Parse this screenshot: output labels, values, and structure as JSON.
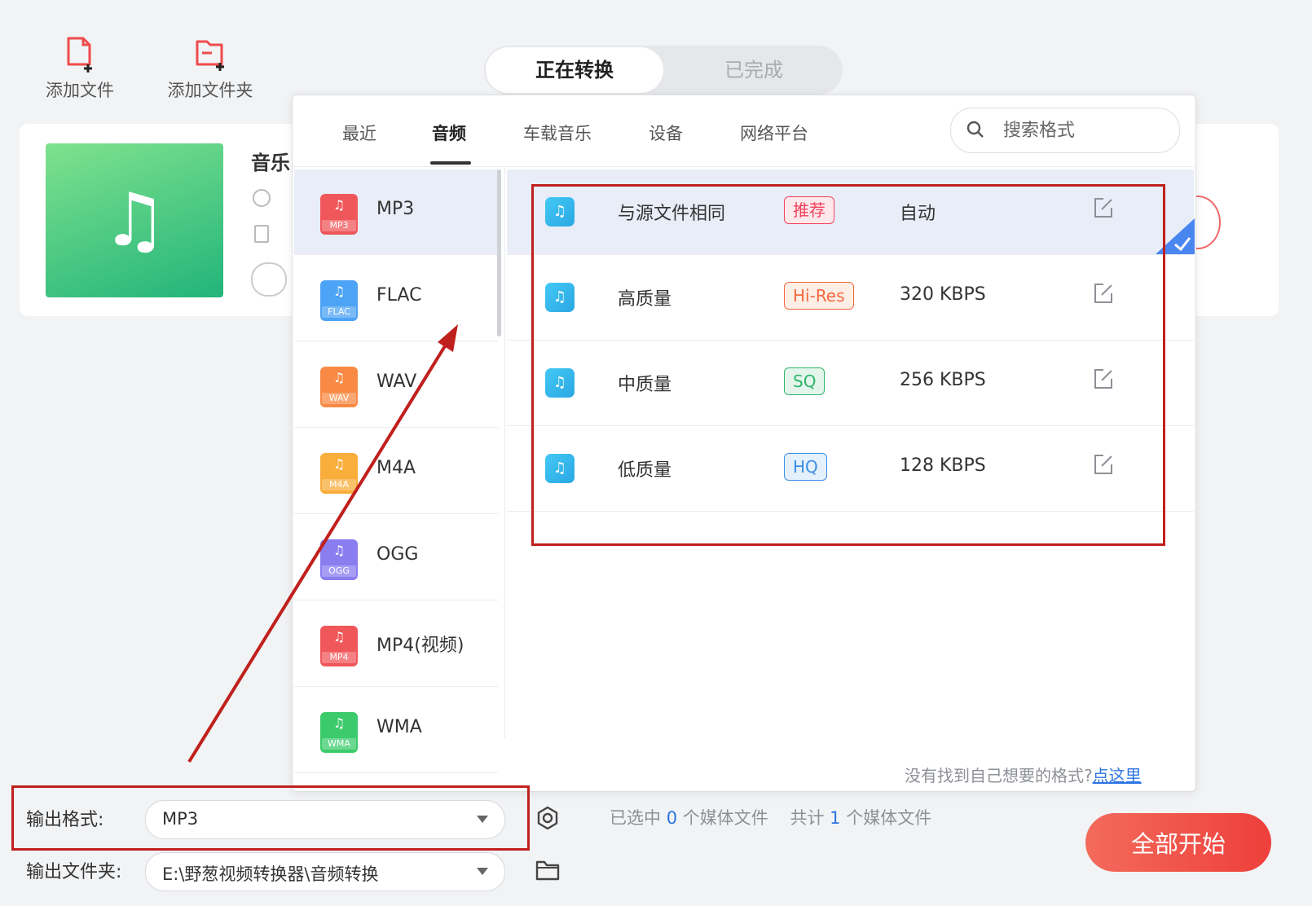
{
  "toolbar": {
    "add_file": "添加文件",
    "add_folder": "添加文件夹"
  },
  "segment": {
    "converting": "正在转换",
    "done": "已完成"
  },
  "file_card": {
    "title": "音乐"
  },
  "popup": {
    "tabs": [
      "最近",
      "音频",
      "车载音乐",
      "设备",
      "网络平台"
    ],
    "active_tab": "音频",
    "search_placeholder": "搜索格式",
    "formats": [
      {
        "label": "MP3",
        "tag": "MP3",
        "color": "#f0575a"
      },
      {
        "label": "FLAC",
        "tag": "FLAC",
        "color": "#4da3f5"
      },
      {
        "label": "WAV",
        "tag": "WAV",
        "color": "#f98a45"
      },
      {
        "label": "M4A",
        "tag": "M4A",
        "color": "#f9ad3a"
      },
      {
        "label": "OGG",
        "tag": "OGG",
        "color": "#8a7df0"
      },
      {
        "label": "MP4(视频)",
        "tag": "MP4",
        "color": "#f0575a"
      },
      {
        "label": "WMA",
        "tag": "WMA",
        "color": "#3ccb6c"
      }
    ],
    "qualities": [
      {
        "name": "与源文件相同",
        "badge": "推荐",
        "badge_color": "#f0435a",
        "badge_bg": "#fde8ec",
        "rate": "自动"
      },
      {
        "name": "高质量",
        "badge": "Hi-Res",
        "badge_color": "#f26a3f",
        "badge_bg": "#fdeee6",
        "rate": "320 KBPS"
      },
      {
        "name": "中质量",
        "badge": "SQ",
        "badge_color": "#2fb56a",
        "badge_bg": "#e4f6ec",
        "rate": "256 KBPS"
      },
      {
        "name": "低质量",
        "badge": "HQ",
        "badge_color": "#3a8fe6",
        "badge_bg": "#e4f0fc",
        "rate": "128 KBPS"
      }
    ],
    "hint_text": "没有找到自己想要的格式?",
    "hint_link": "点这里"
  },
  "bottom": {
    "output_format_label": "输出格式:",
    "output_format_value": "MP3",
    "output_folder_label": "输出文件夹:",
    "output_folder_value": "E:\\野葱视频转换器\\音频转换",
    "selected_prefix": "已选中",
    "selected_count": "0",
    "selected_suffix": "个媒体文件",
    "total_prefix": "共计",
    "total_count": "1",
    "total_suffix": "个媒体文件",
    "start_all": "全部开始"
  }
}
